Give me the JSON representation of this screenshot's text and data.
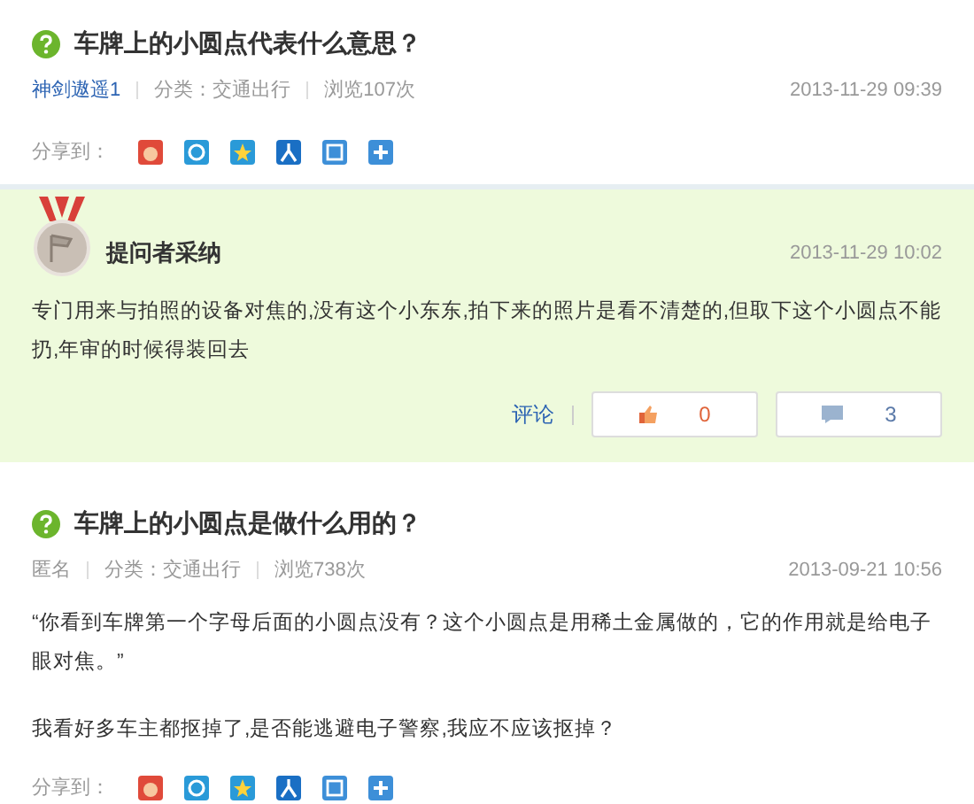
{
  "questions": [
    {
      "title": "车牌上的小圆点代表什么意思？",
      "author": "神剑遨遥1",
      "author_link": true,
      "category": "分类：交通出行",
      "views": "浏览107次",
      "time": "2013-11-29 09:39",
      "share_label": "分享到：",
      "answer": {
        "badge": "提问者采纳",
        "time": "2013-11-29 10:02",
        "text": "专门用来与拍照的设备对焦的,没有这个小东东,拍下来的照片是看不清楚的,但取下这个小圆点不能扔,年审的时候得装回去",
        "comment": "评论",
        "likes": "0",
        "replies": "3"
      }
    },
    {
      "title": "车牌上的小圆点是做什么用的？",
      "author": "匿名",
      "author_link": false,
      "category": "分类：交通出行",
      "views": "浏览738次",
      "time": "2013-09-21 10:56",
      "paragraphs": [
        "“你看到车牌第一个字母后面的小圆点没有？这个小圆点是用稀土金属做的，它的作用就是给电子眼对焦。”",
        "我看好多车主都抠掉了,是否能逃避电子警察,我应不应该抠掉？"
      ],
      "share_label": "分享到："
    }
  ]
}
